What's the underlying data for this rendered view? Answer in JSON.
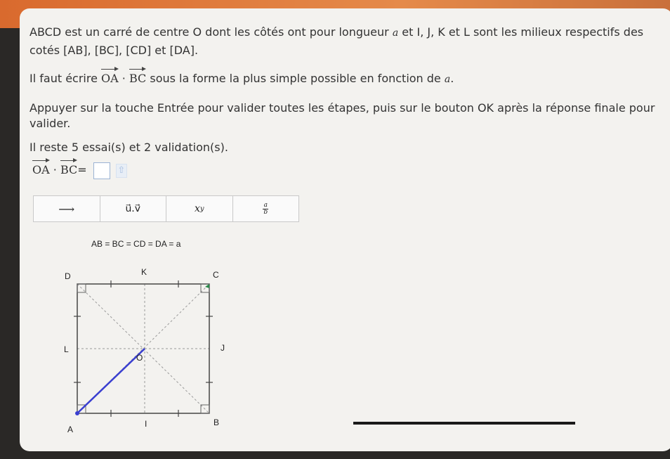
{
  "problem": {
    "line1": "ABCD est un carré de centre O dont les côtés ont pour longueur",
    "var_a": "a",
    "line1b": "et I, J, K et L sont les milieux respectifs des",
    "line2": "cotés [AB], [BC], [CD] et [DA].",
    "line3_pre": "Il faut écrire",
    "vec_OA": "OA",
    "dot": "·",
    "vec_BC": "BC",
    "line3_post": "sous la forme la plus simple possible en fonction de",
    "line3_end": ".",
    "line4": "Appuyer sur la touche Entrée pour valider toutes les étapes, puis sur le bouton OK après la réponse finale pour",
    "line5": "valider.",
    "line6": "Il reste 5 essai(s) et 2 validation(s).",
    "answer_equals": "="
  },
  "toolbar": {
    "btn_arrow": "⟶",
    "btn_dot_product": "u⃗.v⃗",
    "btn_power": "x",
    "btn_power_sup": "y",
    "btn_frac_num": "a",
    "btn_frac_den": "b"
  },
  "figure": {
    "equality": "AB = BC = CD = DA = a",
    "labels": {
      "A": "A",
      "B": "B",
      "C": "C",
      "D": "D",
      "I": "I",
      "J": "J",
      "K": "K",
      "L": "L",
      "O": "O"
    },
    "colors": {
      "highlight": "#3a3fd0",
      "frame": "#444444",
      "dashed": "#9a9a9a",
      "accent_green": "#2a8a4a"
    }
  }
}
